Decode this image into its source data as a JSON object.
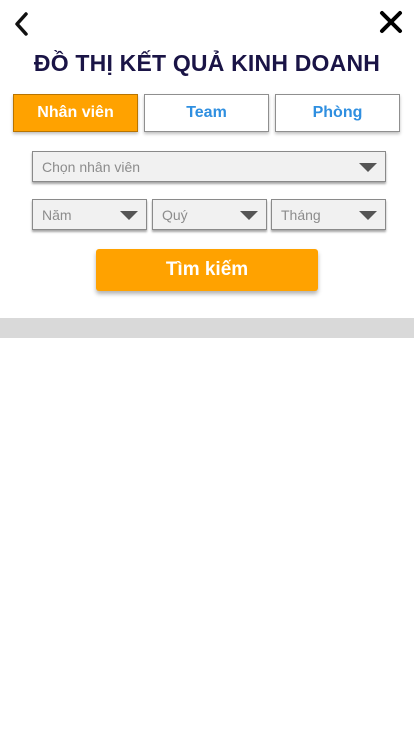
{
  "header": {
    "back_icon": "chevron-left-icon",
    "close_icon": "close-icon",
    "title": "ĐỒ THỊ KẾT QUẢ KINH DOANH"
  },
  "tabs": [
    {
      "label": "Nhân viên",
      "active": true
    },
    {
      "label": "Team",
      "active": false
    },
    {
      "label": "Phòng",
      "active": false
    }
  ],
  "filters": {
    "employee": {
      "value": "Chọn nhân viên"
    },
    "year": {
      "value": "Năm"
    },
    "quarter": {
      "value": "Quý"
    },
    "month": {
      "value": "Tháng"
    }
  },
  "search_button": {
    "label": "Tìm kiếm"
  },
  "colors": {
    "accent": "#ffa200",
    "title": "#1a1446",
    "tab_text": "#2f8fe0",
    "band": "#d9d9d9"
  }
}
